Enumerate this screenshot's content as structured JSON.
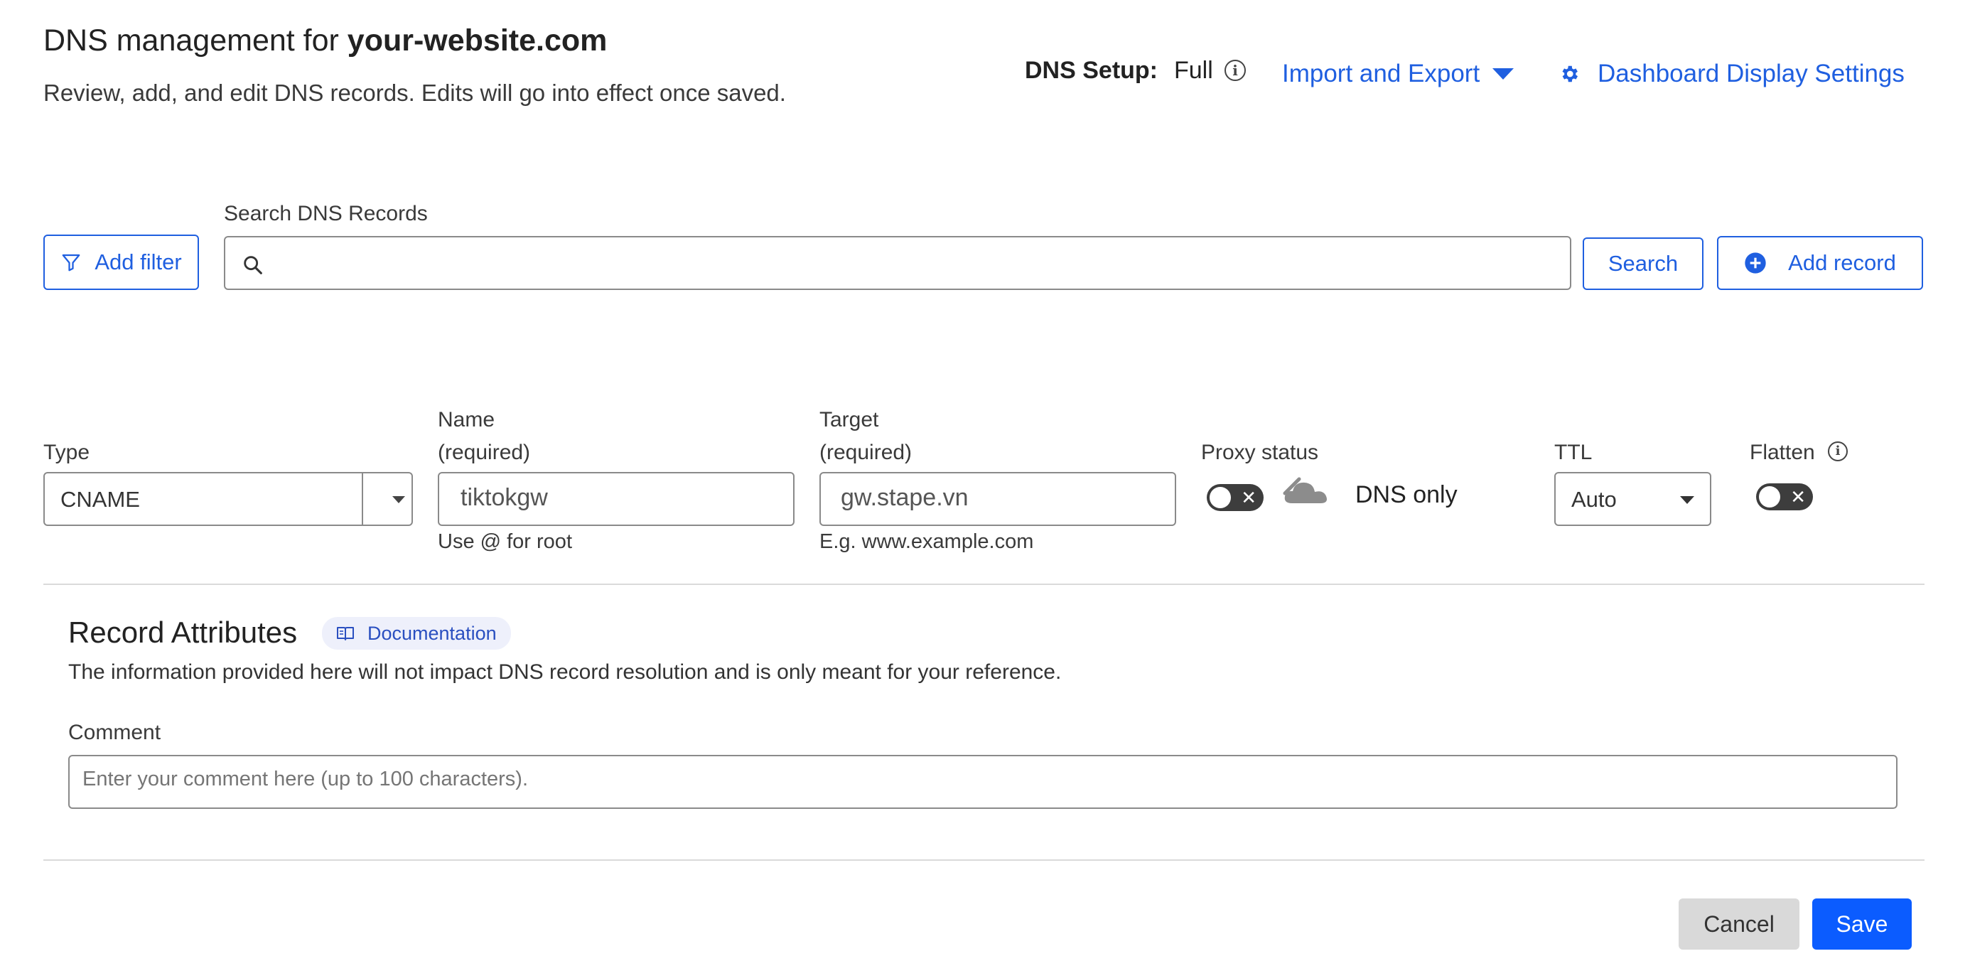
{
  "header": {
    "title_prefix": "DNS management for ",
    "domain": "your-website.com",
    "subtitle": "Review, add, and edit DNS records. Edits will go into effect once saved.",
    "dns_setup_label": "DNS Setup:",
    "dns_setup_value": "Full",
    "import_export_label": "Import and Export",
    "dashboard_settings_label": "Dashboard Display Settings"
  },
  "toolbar": {
    "add_filter_label": "Add filter",
    "search_label": "Search DNS Records",
    "search_value": "",
    "search_button_label": "Search",
    "add_record_label": "Add record"
  },
  "record_form": {
    "type_label": "Type",
    "type_value": "CNAME",
    "name_label": "Name",
    "name_required": "(required)",
    "name_value": "tiktokgw",
    "name_hint": "Use @ for root",
    "target_label": "Target",
    "target_required": "(required)",
    "target_value": "gw.stape.vn",
    "target_hint": "E.g. www.example.com",
    "proxy_label": "Proxy status",
    "proxy_value": "DNS only",
    "ttl_label": "TTL",
    "ttl_value": "Auto",
    "flatten_label": "Flatten"
  },
  "attributes": {
    "title": "Record Attributes",
    "documentation_label": "Documentation",
    "description": "The information provided here will not impact DNS record resolution and is only meant for your reference.",
    "comment_label": "Comment",
    "comment_placeholder": "Enter your comment here (up to 100 characters)."
  },
  "actions": {
    "cancel_label": "Cancel",
    "save_label": "Save"
  },
  "colors": {
    "accent": "#1f5fe0",
    "save_bg": "#0b5cff",
    "cancel_bg": "#d9d9d9",
    "toggle_off": "#3d3d3d"
  },
  "icons": {
    "info": "info-icon",
    "import_export": "caret-down-icon",
    "settings": "gear-icon",
    "filter": "filter-icon",
    "search": "search-icon",
    "add": "plus-circle-icon",
    "proxy": "cloud-icon",
    "documentation": "book-icon"
  }
}
